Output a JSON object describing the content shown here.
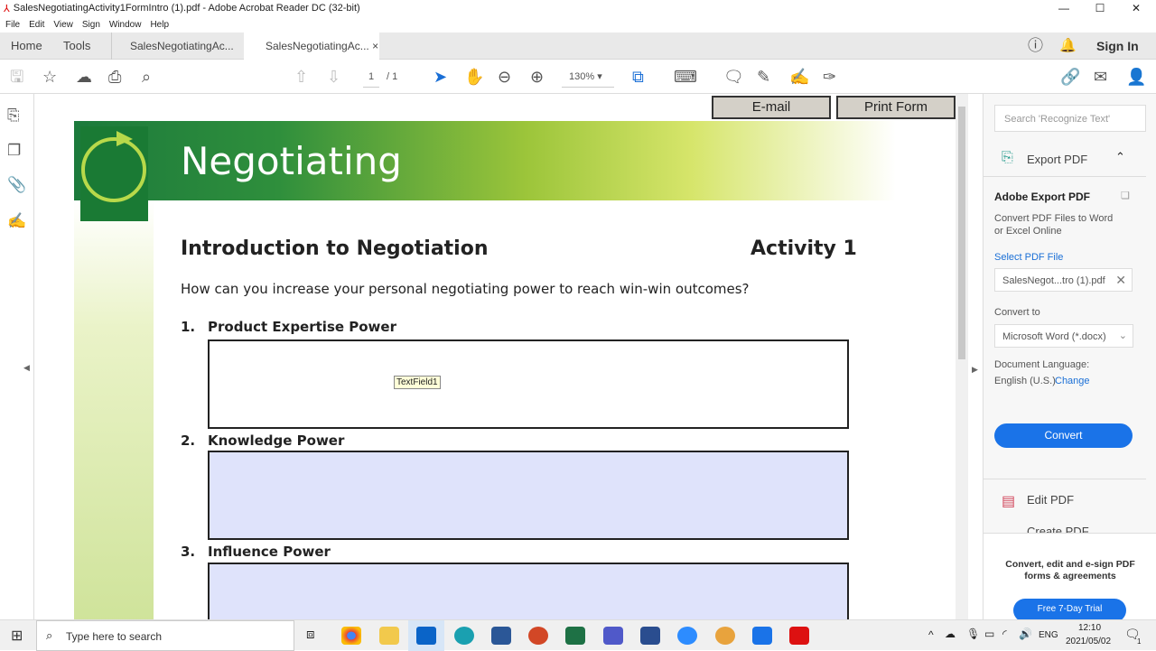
{
  "window": {
    "title": "SalesNegotiatingActivity1FormIntro (1).pdf - Adobe Acrobat Reader DC (32-bit)",
    "minimize": "—",
    "maximize": "☐",
    "close": "✕"
  },
  "menu": [
    "File",
    "Edit",
    "View",
    "Sign",
    "Window",
    "Help"
  ],
  "tabs": {
    "home": "Home",
    "tools": "Tools",
    "doc1": "SalesNegotiatingAc...",
    "doc2": "SalesNegotiatingAc...",
    "close": "×",
    "signin": "Sign In"
  },
  "toolbar": {
    "page_current": "1",
    "page_total": "/ 1",
    "zoom": "130%"
  },
  "form": {
    "email": "E-mail",
    "print": "Print Form"
  },
  "doc": {
    "banner_title": "Negotiating",
    "heading": "Introduction to Negotiation",
    "activity": "Activity 1",
    "question": "How can you increase your personal negotiating power to reach win-win outcomes?",
    "items": [
      {
        "num": "1.",
        "label": "Product Expertise Power"
      },
      {
        "num": "2.",
        "label": "Knowledge Power"
      },
      {
        "num": "3.",
        "label": "Influence Power"
      }
    ],
    "tooltip": "TextField1"
  },
  "right_panel": {
    "search_placeholder": "Search 'Recognize Text'",
    "export_title": "Export PDF",
    "adobe_export": "Adobe Export PDF",
    "desc": "Convert PDF Files to Word or Excel Online",
    "select_file": "Select PDF File",
    "file_name": "SalesNegot...tro (1).pdf",
    "convert_to": "Convert to",
    "format": "Microsoft Word (*.docx)",
    "lang_label": "Document Language:",
    "lang_value": "English (U.S.)",
    "change": "Change",
    "convert": "Convert",
    "edit_pdf": "Edit PDF",
    "create_pdf": "Create PDF",
    "promo": "Convert, edit and e-sign PDF forms & agreements",
    "trial": "Free 7-Day Trial"
  },
  "taskbar": {
    "search": "Type here to search",
    "lang": "ENG",
    "time": "12:10",
    "date": "2021/05/02",
    "notif": "1"
  }
}
